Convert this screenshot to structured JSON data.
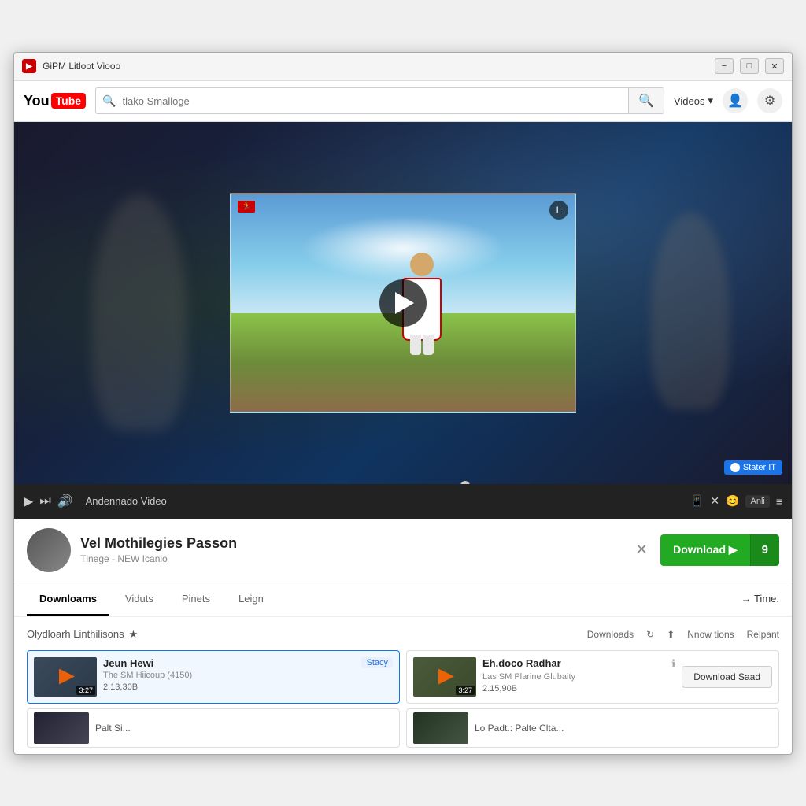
{
  "window": {
    "title": "GiPM Litloot Viooo",
    "minimize_label": "−",
    "maximize_label": "□",
    "close_label": "✕"
  },
  "nav": {
    "logo_you": "You",
    "logo_tube": "Tube",
    "search_placeholder": "tlako Smalloge",
    "search_icon": "🔍",
    "videos_label": "Videos",
    "account_icon": "👤",
    "settings_icon": "⚙"
  },
  "video": {
    "stater_badge": "Stater IT",
    "progress_pct": 58
  },
  "controls": {
    "play_label": "▶",
    "next_label": "⏭",
    "volume_label": "🔊",
    "title": "Andennado Video",
    "icon1": "📱",
    "icon2": "✕",
    "icon3": "😊",
    "badge": "Anli",
    "menu": "≡"
  },
  "info": {
    "title": "Vel Mothilegies Passon",
    "subtitle": "Tlnege - NEW Icanio",
    "dismiss": "✕",
    "download_label": "Download ▶",
    "download_count": "9"
  },
  "tabs": {
    "items": [
      {
        "label": "Downloams",
        "active": true
      },
      {
        "label": "Viduts",
        "active": false
      },
      {
        "label": "Pinets",
        "active": false
      },
      {
        "label": "Leign",
        "active": false
      }
    ],
    "time_label": "→ Time."
  },
  "section": {
    "title": "Olydloarh Linthilisons",
    "star_icon": "★",
    "downloads_label": "Downloads",
    "refresh_icon": "↻",
    "upload_icon": "⬆",
    "notif_label": "Nnow tions",
    "report_label": "Relpant"
  },
  "download_items": [
    {
      "id": "item1",
      "selected": true,
      "thumb_color1": "#3a4a5a",
      "thumb_color2": "#2a3a4a",
      "duration": "3:27",
      "title": "Jeun Hewi",
      "subtitle": "The SM Hiicoup (4150)",
      "size": "2.13,30B",
      "badge": "Stacy",
      "show_badge": true
    },
    {
      "id": "item2",
      "selected": false,
      "thumb_color1": "#4a5a3a",
      "thumb_color2": "#3a4a2a",
      "duration": "3:27",
      "title": "Eh.doco Radhar",
      "subtitle": "Las SM Plarine Glubaity",
      "size": "2.15,90B",
      "has_info": true,
      "action_btn": "Download Saad"
    }
  ],
  "more_items": [
    {
      "title": "Palt Si...",
      "thumb_color": "#335"
    },
    {
      "title": "Lo Padt.: Palte Clta...",
      "thumb_color": "#353"
    }
  ]
}
